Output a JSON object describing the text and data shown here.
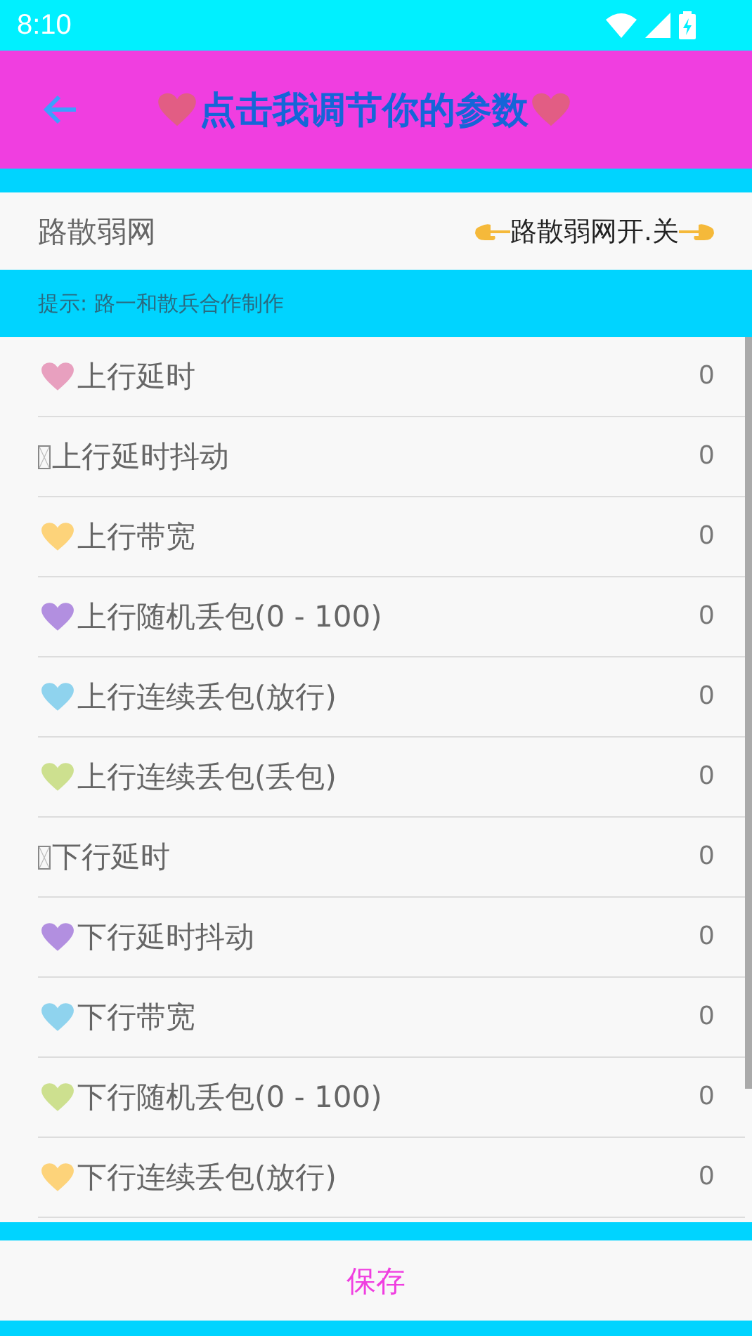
{
  "status_bar": {
    "time": "8:10"
  },
  "header": {
    "title": "点击我调节你的参数"
  },
  "toggle_row": {
    "label": "路散弱网",
    "switch_label": "路散弱网开.关"
  },
  "tip": "提示: 路一和散兵合作制作",
  "params": [
    {
      "kind": "heart",
      "color": "#e8a0bf",
      "label": "上行延时",
      "value": "0"
    },
    {
      "kind": "missing",
      "label": "上行延时抖动",
      "value": "0"
    },
    {
      "kind": "heart",
      "color": "#fdd37a",
      "label": "上行带宽",
      "value": "0"
    },
    {
      "kind": "heart",
      "color": "#b28fe0",
      "label": "上行随机丢包(0 - 100)",
      "value": "0"
    },
    {
      "kind": "heart",
      "color": "#8fd3ee",
      "label": "上行连续丢包(放行)",
      "value": "0"
    },
    {
      "kind": "heart",
      "color": "#cde08f",
      "label": "上行连续丢包(丢包)",
      "value": "0"
    },
    {
      "kind": "missing",
      "label": "下行延时",
      "value": "0"
    },
    {
      "kind": "heart",
      "color": "#b28fe0",
      "label": "下行延时抖动",
      "value": "0"
    },
    {
      "kind": "heart",
      "color": "#8fd3ee",
      "label": "下行带宽",
      "value": "0"
    },
    {
      "kind": "heart",
      "color": "#cde08f",
      "label": "下行随机丢包(0 - 100)",
      "value": "0"
    },
    {
      "kind": "heart",
      "color": "#fdd37a",
      "label": "下行连续丢包(放行)",
      "value": "0"
    }
  ],
  "save_button": "保存"
}
